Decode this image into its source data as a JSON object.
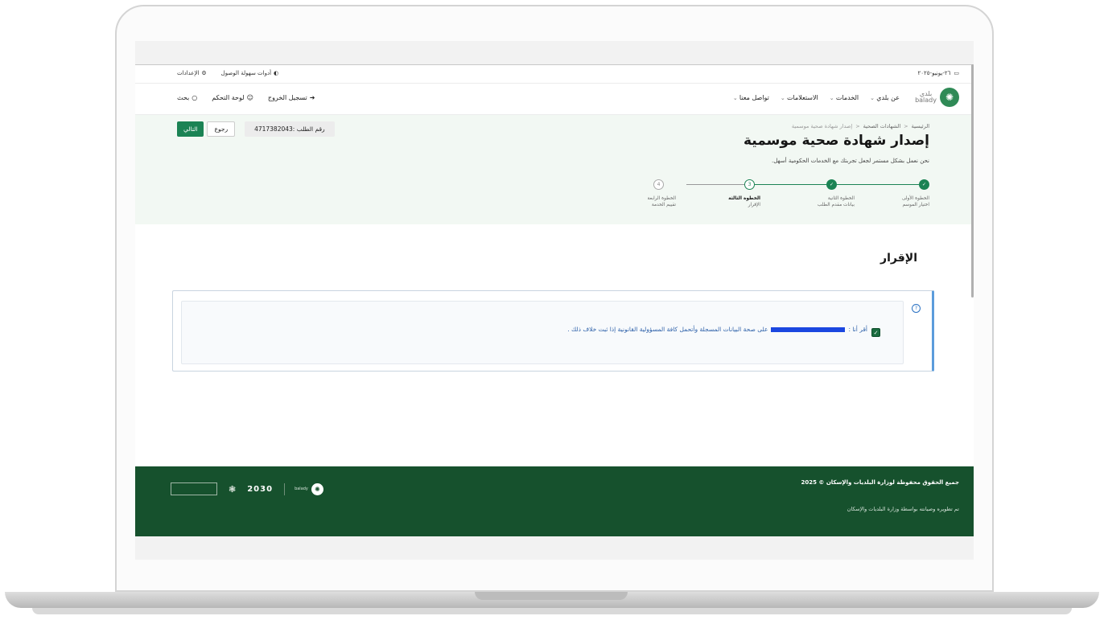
{
  "utility": {
    "date": "٢٦-يونيو-٢٠٢٥",
    "accessibility": "أدوات سهولة الوصول",
    "settings": "الإعدادات"
  },
  "header": {
    "logo_ar": "بلدي",
    "logo_en": "balady",
    "nav": [
      "عن بلدي",
      "الخدمات",
      "الاستعلامات",
      "تواصل معنا"
    ],
    "search": "بحث",
    "dashboard": "لوحة التحكم",
    "logout": "تسجيل الخروج"
  },
  "breadcrumb": {
    "home": "الرئيسية",
    "health_certs": "الشهادات الصحية",
    "current": "إصدار شهادة صحية موسمية"
  },
  "page": {
    "title": "إصدار شهادة صحية موسمية",
    "subtitle": "نحن نعمل بشكل مستمر لجعل تجربتك مع الخدمات الحكومية أسهل.",
    "request_number": "رقم الطلب :4717382043",
    "back": "رجوع",
    "next": "التالي"
  },
  "steps": [
    {
      "title": "الخطوة الأولى",
      "name": "اختيار الموسم",
      "status": "done",
      "mark": "✓"
    },
    {
      "title": "الخطوة الثانية",
      "name": "بيانات مقدم الطلب",
      "status": "done",
      "mark": "✓"
    },
    {
      "title": "الخطوة الثالثة",
      "name": "الإقرار",
      "status": "active",
      "mark": "3"
    },
    {
      "title": "الخطوة الرابعة",
      "name": "تقييم الخدمة",
      "status": "todo",
      "mark": "4"
    }
  ],
  "declaration": {
    "section_title": "الإقرار",
    "prefix": "أقر أنا :",
    "suffix": "على صحة البيانات المسجلة وأتحمل كافة المسؤولية القانونية إذا ثبت خلاف ذلك .",
    "checked": true
  },
  "footer": {
    "rights": "جميع الحقوق محفوظة لوزارة البلديات والإسكان © 2025",
    "developed": "تم تطويره وصيانته بواسطة وزارة البلديات والإسكان",
    "vision": "2030"
  },
  "colors": {
    "primary": "#1b8354",
    "footer": "#16512d",
    "hero": "#f2f8f3",
    "info_border": "#5b9cdb"
  }
}
